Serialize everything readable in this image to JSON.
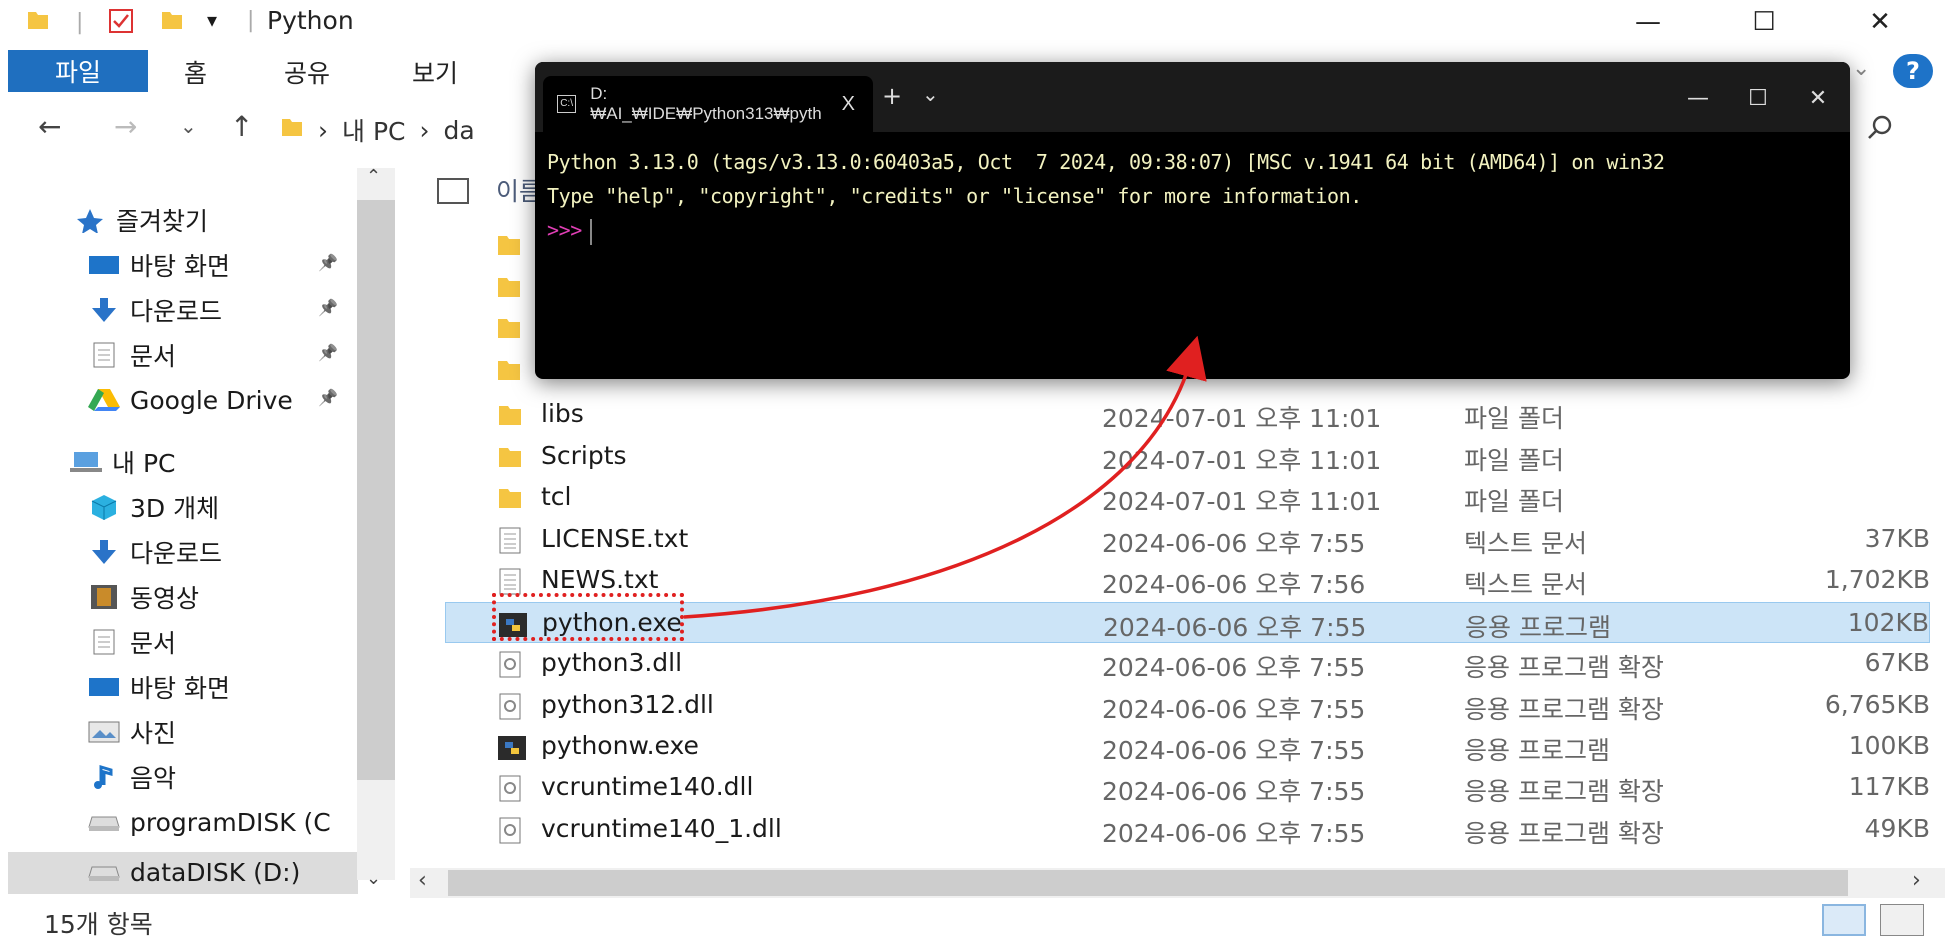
{
  "window": {
    "title": "Python",
    "minimize": "—",
    "maximize": "☐",
    "close": "✕"
  },
  "ribbon": {
    "tabs": [
      "파일",
      "홈",
      "공유",
      "보기"
    ],
    "help": "?"
  },
  "address": {
    "parts": [
      "내 PC",
      "da"
    ]
  },
  "nav": {
    "items": [
      {
        "label": "즐겨찾기",
        "icon": "star-icon",
        "pinned": false
      },
      {
        "label": "바탕 화면",
        "icon": "desktop-icon",
        "pinned": true
      },
      {
        "label": "다운로드",
        "icon": "download-icon",
        "pinned": true
      },
      {
        "label": "문서",
        "icon": "document-icon",
        "pinned": true
      },
      {
        "label": "Google Drive",
        "icon": "google-drive-icon",
        "pinned": true
      },
      {
        "label": "내 PC",
        "icon": "pc-icon",
        "pinned": false
      },
      {
        "label": "3D 개체",
        "icon": "cube-icon",
        "pinned": false
      },
      {
        "label": "다운로드",
        "icon": "download-icon",
        "pinned": false
      },
      {
        "label": "동영상",
        "icon": "video-icon",
        "pinned": false
      },
      {
        "label": "문서",
        "icon": "document-icon",
        "pinned": false
      },
      {
        "label": "바탕 화면",
        "icon": "desktop-icon",
        "pinned": false
      },
      {
        "label": "사진",
        "icon": "pictures-icon",
        "pinned": false
      },
      {
        "label": "음악",
        "icon": "music-icon",
        "pinned": false
      },
      {
        "label": "programDISK (C",
        "icon": "drive-icon",
        "pinned": false
      },
      {
        "label": "dataDISK (D:)",
        "icon": "drive-icon",
        "pinned": false
      }
    ]
  },
  "list": {
    "header_name": "이름",
    "rows": [
      {
        "name": "libs",
        "date": "2024-07-01 오후 11:01",
        "type": "파일 폴더",
        "size": "",
        "icon": "folder-icon"
      },
      {
        "name": "Scripts",
        "date": "2024-07-01 오후 11:01",
        "type": "파일 폴더",
        "size": "",
        "icon": "folder-icon"
      },
      {
        "name": "tcl",
        "date": "2024-07-01 오후 11:01",
        "type": "파일 폴더",
        "size": "",
        "icon": "folder-icon"
      },
      {
        "name": "LICENSE.txt",
        "date": "2024-06-06 오후 7:55",
        "type": "텍스트 문서",
        "size": "37KB",
        "icon": "text-file-icon"
      },
      {
        "name": "NEWS.txt",
        "date": "2024-06-06 오후 7:56",
        "type": "텍스트 문서",
        "size": "1,702KB",
        "icon": "text-file-icon"
      },
      {
        "name": "python.exe",
        "date": "2024-06-06 오후 7:55",
        "type": "응용 프로그램",
        "size": "102KB",
        "icon": "python-icon"
      },
      {
        "name": "python3.dll",
        "date": "2024-06-06 오후 7:55",
        "type": "응용 프로그램 확장",
        "size": "67KB",
        "icon": "dll-icon"
      },
      {
        "name": "python312.dll",
        "date": "2024-06-06 오후 7:55",
        "type": "응용 프로그램 확장",
        "size": "6,765KB",
        "icon": "dll-icon"
      },
      {
        "name": "pythonw.exe",
        "date": "2024-06-06 오후 7:55",
        "type": "응용 프로그램",
        "size": "100KB",
        "icon": "python-icon"
      },
      {
        "name": "vcruntime140.dll",
        "date": "2024-06-06 오후 7:55",
        "type": "응용 프로그램 확장",
        "size": "117KB",
        "icon": "dll-icon"
      },
      {
        "name": "vcruntime140_1.dll",
        "date": "2024-06-06 오후 7:55",
        "type": "응용 프로그램 확장",
        "size": "49KB",
        "icon": "dll-icon"
      }
    ]
  },
  "status": {
    "count": "15개 항목"
  },
  "terminal": {
    "tab_title": "D:₩AI_₩IDE₩Python313₩pyth",
    "tab_close": "X",
    "new_tab": "+",
    "dropdown": "⌄",
    "line1": "Python 3.13.0 (tags/v3.13.0:60403a5, Oct  7 2024, 09:38:07) [MSC v.1941 64 bit (AMD64)] on win32",
    "line2": "Type \"help\", \"copyright\", \"credits\" or \"license\" for more information.",
    "prompt": ">>>"
  },
  "colors": {
    "accent": "#1f6fbf",
    "annotation": "#e02020",
    "selected_row": "#cce4f7"
  }
}
